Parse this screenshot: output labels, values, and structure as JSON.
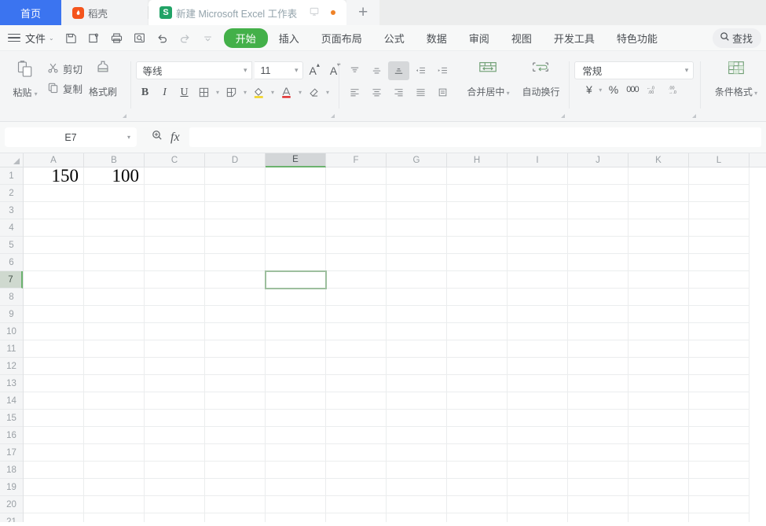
{
  "tabstrip": {
    "home_tab": "首页",
    "docer_tab": "稻壳",
    "docer_icon": "docer-flame-icon",
    "document_tab": "新建 Microsoft Excel 工作表",
    "document_icon": "excel-s-icon",
    "cast_icon": "cast-screen-icon",
    "modified_dot": "unsaved-changes-dot",
    "new_tab": "+"
  },
  "menubar": {
    "menu_icon": "hamburger-icon",
    "file_label": "文件",
    "file_caret": "⌄",
    "quick_access": [
      {
        "name": "save-icon",
        "glyph": "save"
      },
      {
        "name": "save-as-icon",
        "glyph": "saveas"
      },
      {
        "name": "print-icon",
        "glyph": "print"
      },
      {
        "name": "print-preview-icon",
        "glyph": "preview"
      },
      {
        "name": "undo-icon",
        "glyph": "undo"
      },
      {
        "name": "redo-icon",
        "glyph": "redo"
      },
      {
        "name": "customize-icon",
        "glyph": "more"
      }
    ],
    "ribbon_tabs": [
      {
        "label": "开始",
        "active": true
      },
      {
        "label": "插入",
        "active": false
      },
      {
        "label": "页面布局",
        "active": false
      },
      {
        "label": "公式",
        "active": false
      },
      {
        "label": "数据",
        "active": false
      },
      {
        "label": "审阅",
        "active": false
      },
      {
        "label": "视图",
        "active": false
      },
      {
        "label": "开发工具",
        "active": false
      },
      {
        "label": "特色功能",
        "active": false
      }
    ],
    "search_label": "查找",
    "search_icon": "search-icon"
  },
  "ribbon": {
    "clipboard": {
      "paste_label": "粘贴",
      "paste_icon": "paste-icon",
      "cut_label": "剪切",
      "cut_icon": "scissors-icon",
      "copy_label": "复制",
      "copy_icon": "copy-icon",
      "format_painter_label": "格式刷",
      "format_painter_icon": "format-painter-icon"
    },
    "font": {
      "font_name": "等线",
      "font_size": "11",
      "grow_font_label": "A",
      "shrink_font_label": "A",
      "bold_label": "B",
      "italic_label": "I",
      "underline_label": "U",
      "borders_icon": "borders-icon",
      "cell_style_icon": "cell-style-icon",
      "fill_color_icon": "fill-color-icon",
      "font_color_icon": "font-color-icon",
      "clear_format_icon": "clear-format-icon",
      "fill_color": "#f2d218",
      "font_color": "#e02020"
    },
    "alignment": {
      "align_top_icon": "align-top-icon",
      "align_middle_icon": "align-middle-icon",
      "align_bottom_icon": "align-bottom-icon",
      "decrease_indent_icon": "decrease-indent-icon",
      "increase_indent_icon": "increase-indent-icon",
      "align_left_icon": "align-left-icon",
      "align_center_icon": "align-center-icon",
      "align_right_icon": "align-right-icon",
      "align_justify_icon": "align-justify-icon",
      "orientation_icon": "text-orientation-icon",
      "merge_label": "合并居中",
      "merge_icon": "merge-cells-icon",
      "wrap_label": "自动换行",
      "wrap_icon": "wrap-text-icon",
      "selected": "align-bottom-icon"
    },
    "number": {
      "format_value": "常规",
      "currency_icon": "currency-yuan-icon",
      "percent_icon": "percent-icon",
      "comma_icon": "comma-style-icon",
      "increase_decimal_icon": "increase-decimal-icon",
      "decrease_decimal_icon": "decrease-decimal-icon"
    },
    "styles": {
      "conditional_label": "条件格式",
      "conditional_icon": "conditional-format-icon"
    }
  },
  "formula_bar": {
    "name_box_value": "E7",
    "name_box_caret": "▾",
    "zoom_icon": "magnifier-icon",
    "fx_label": "fx",
    "formula_value": "",
    "formula_placeholder": ""
  },
  "grid": {
    "columns": [
      "A",
      "B",
      "C",
      "D",
      "E",
      "F",
      "G",
      "H",
      "I",
      "J",
      "K",
      "L"
    ],
    "selected_column": "E",
    "rows": [
      "1",
      "2",
      "3",
      "4",
      "5",
      "6",
      "7",
      "8",
      "9",
      "10",
      "11",
      "12",
      "13",
      "14",
      "15",
      "16",
      "17",
      "18",
      "19",
      "20",
      "21"
    ],
    "selected_row": "7",
    "active_cell": "E7",
    "cell_values": [
      {
        "ref": "A1",
        "row": 0,
        "col": 0,
        "value": "150"
      },
      {
        "ref": "B1",
        "row": 0,
        "col": 1,
        "value": "100"
      }
    ],
    "selection_color": "#9dbf9e",
    "header_selected_bg": "#d3d6d8"
  }
}
